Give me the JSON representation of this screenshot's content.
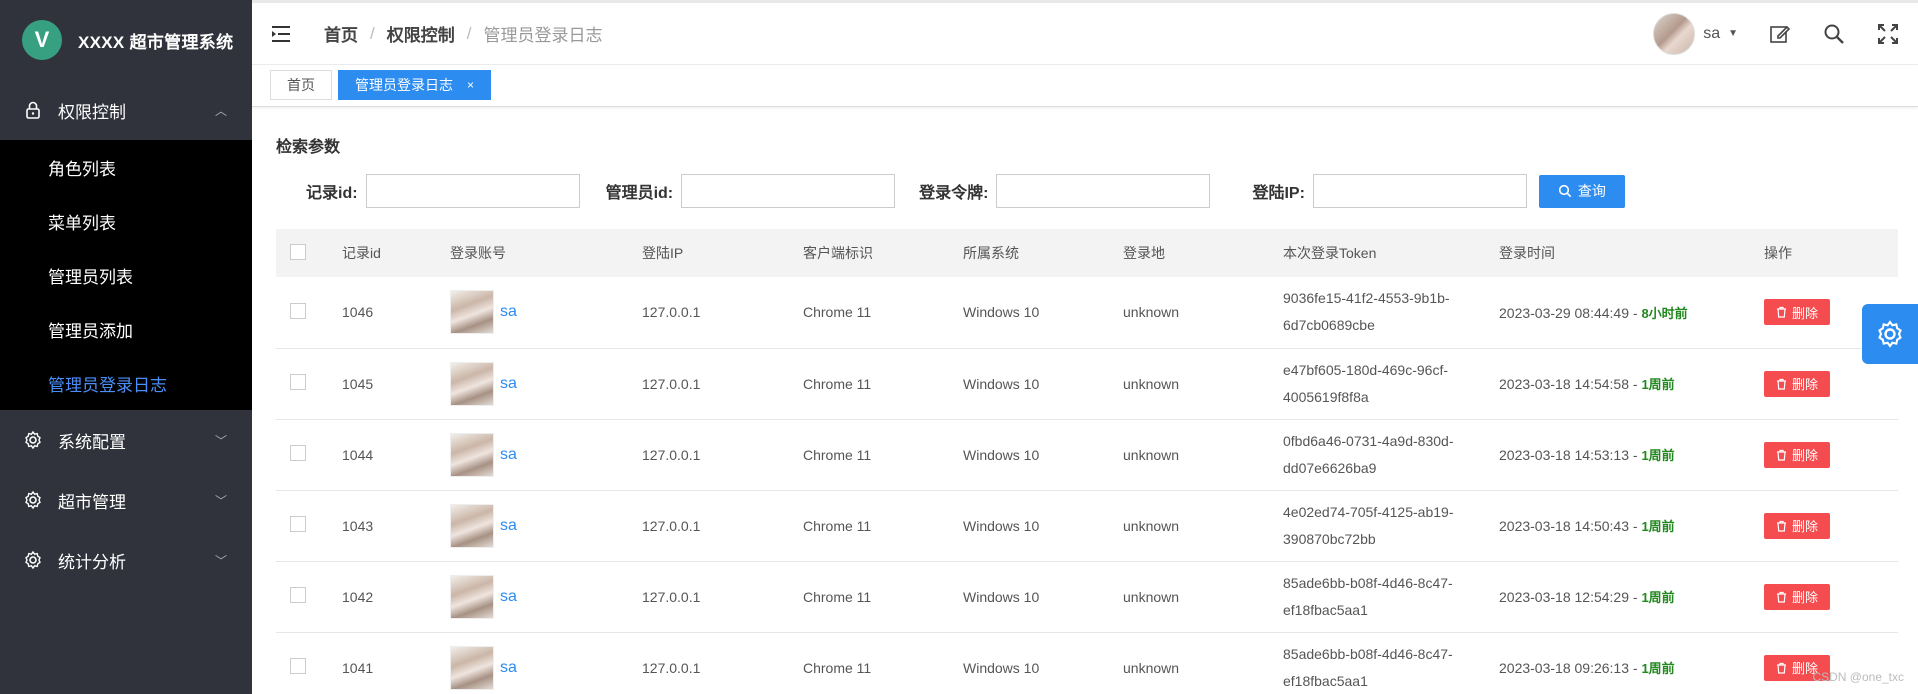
{
  "brand": {
    "logo_letter": "V",
    "title": "XXXX 超市管理系统"
  },
  "sidebar": {
    "groups": [
      {
        "label": "权限控制",
        "icon": "lock-icon",
        "expanded": true
      },
      {
        "label": "系统配置",
        "icon": "gear-icon",
        "expanded": false
      },
      {
        "label": "超市管理",
        "icon": "gear-icon",
        "expanded": false
      },
      {
        "label": "统计分析",
        "icon": "gear-icon",
        "expanded": false
      }
    ],
    "sub_items": [
      {
        "label": "角色列表"
      },
      {
        "label": "菜单列表"
      },
      {
        "label": "管理员列表"
      },
      {
        "label": "管理员添加"
      },
      {
        "label": "管理员登录日志",
        "active": true
      }
    ]
  },
  "header": {
    "breadcrumb": [
      "首页",
      "权限控制",
      "管理员登录日志"
    ],
    "user_name": "sa"
  },
  "tabs": [
    {
      "label": "首页",
      "active": false
    },
    {
      "label": "管理员登录日志",
      "active": true,
      "close": "×"
    }
  ],
  "search": {
    "title": "检索参数",
    "fields": [
      {
        "label": "记录id:",
        "value": ""
      },
      {
        "label": "管理员id:",
        "value": ""
      },
      {
        "label": "登录令牌:",
        "value": ""
      },
      {
        "label": "登陆IP:",
        "value": ""
      }
    ],
    "button_label": "查询"
  },
  "table": {
    "columns": [
      "记录id",
      "登录账号",
      "登陆IP",
      "客户端标识",
      "所属系统",
      "登录地",
      "本次登录Token",
      "登录时间",
      "操作"
    ],
    "delete_label": "删除",
    "rows": [
      {
        "id": "1046",
        "account": "sa",
        "ip": "127.0.0.1",
        "client": "Chrome 11",
        "os": "Windows 10",
        "location": "unknown",
        "token1": "9036fe15-41f2-4553-9b1b-",
        "token2": "6d7cb0689cbe",
        "time": "2023-03-29 08:44:49 -",
        "ago": "8小时前"
      },
      {
        "id": "1045",
        "account": "sa",
        "ip": "127.0.0.1",
        "client": "Chrome 11",
        "os": "Windows 10",
        "location": "unknown",
        "token1": "e47bf605-180d-469c-96cf-",
        "token2": "4005619f8f8a",
        "time": "2023-03-18 14:54:58 -",
        "ago": "1周前"
      },
      {
        "id": "1044",
        "account": "sa",
        "ip": "127.0.0.1",
        "client": "Chrome 11",
        "os": "Windows 10",
        "location": "unknown",
        "token1": "0fbd6a46-0731-4a9d-830d-",
        "token2": "dd07e6626ba9",
        "time": "2023-03-18 14:53:13 -",
        "ago": "1周前"
      },
      {
        "id": "1043",
        "account": "sa",
        "ip": "127.0.0.1",
        "client": "Chrome 11",
        "os": "Windows 10",
        "location": "unknown",
        "token1": "4e02ed74-705f-4125-ab19-",
        "token2": "390870bc72bb",
        "time": "2023-03-18 14:50:43 -",
        "ago": "1周前"
      },
      {
        "id": "1042",
        "account": "sa",
        "ip": "127.0.0.1",
        "client": "Chrome 11",
        "os": "Windows 10",
        "location": "unknown",
        "token1": "85ade6bb-b08f-4d46-8c47-",
        "token2": "ef18fbac5aa1",
        "time": "2023-03-18 12:54:29 -",
        "ago": "1周前"
      },
      {
        "id": "1041",
        "account": "sa",
        "ip": "127.0.0.1",
        "client": "Chrome 11",
        "os": "Windows 10",
        "location": "unknown",
        "token1": "85ade6bb-b08f-4d46-8c47-",
        "token2": "ef18fbac5aa1",
        "time": "2023-03-18 09:26:13 -",
        "ago": "1周前"
      }
    ]
  },
  "watermark": "CSDN @one_txc",
  "colors": {
    "accent": "#2d8cf0",
    "danger": "#f54d4f",
    "sidebar_bg": "#30333b",
    "ago_green": "#22881f"
  }
}
